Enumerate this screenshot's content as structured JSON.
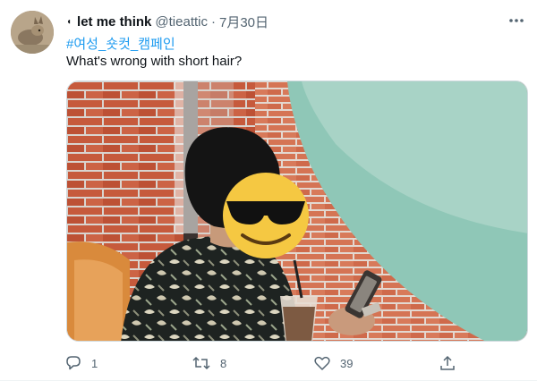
{
  "tweet": {
    "pin_icon": "pin-icon",
    "display_name": "let me think",
    "handle": "@tieattic",
    "separator": "·",
    "date": "7月30日",
    "hashtag": "#여성_숏컷_캠페인",
    "text": "What's wrong with short hair?",
    "more_icon": "more-horizontal-icon"
  },
  "media": {
    "description_icon": "photo",
    "face_cover_icon": "sunglasses-emoji-icon"
  },
  "actions": {
    "reply": {
      "icon": "reply-icon",
      "count": "1"
    },
    "retweet": {
      "icon": "retweet-icon",
      "count": "8"
    },
    "like": {
      "icon": "like-icon",
      "count": "39"
    },
    "share": {
      "icon": "share-icon",
      "count": ""
    }
  },
  "colors": {
    "link": "#1d9bf0",
    "text": "#0f1419",
    "muted": "#536471",
    "brick": "#c8563a",
    "wall_teal": "#7fc1b0"
  }
}
